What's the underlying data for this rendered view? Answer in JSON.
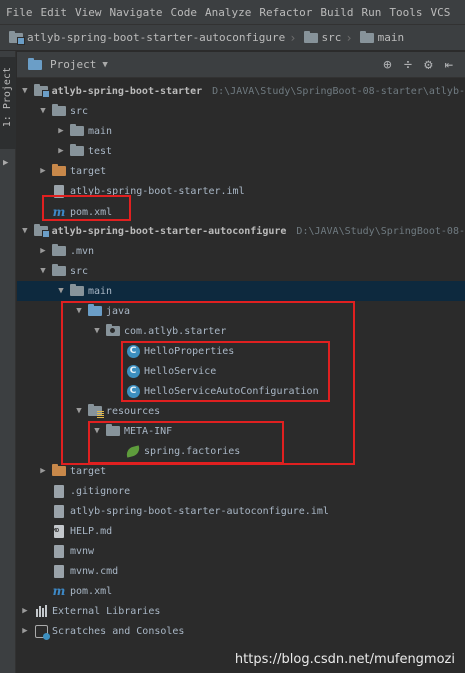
{
  "menu": [
    "File",
    "Edit",
    "View",
    "Navigate",
    "Code",
    "Analyze",
    "Refactor",
    "Build",
    "Run",
    "Tools",
    "VCS"
  ],
  "breadcrumb": [
    "atlyb-spring-boot-starter-autoconfigure",
    "src",
    "main"
  ],
  "side_tab_label": "1: Project",
  "panel": {
    "title": "Project"
  },
  "tree": [
    {
      "label": "atlyb-spring-boot-starter",
      "path": "D:\\JAVA\\Study\\SpringBoot-08-starter\\atlyb-"
    },
    {
      "label": "src"
    },
    {
      "label": "main"
    },
    {
      "label": "test"
    },
    {
      "label": "target"
    },
    {
      "label": "atlyb-spring-boot-starter.iml"
    },
    {
      "label": "pom.xml"
    },
    {
      "label": "atlyb-spring-boot-starter-autoconfigure",
      "path": "D:\\JAVA\\Study\\SpringBoot-08-"
    },
    {
      "label": ".mvn"
    },
    {
      "label": "src"
    },
    {
      "label": "main"
    },
    {
      "label": "java"
    },
    {
      "label": "com.atlyb.starter"
    },
    {
      "label": "HelloProperties"
    },
    {
      "label": "HelloService"
    },
    {
      "label": "HelloServiceAutoConfiguration"
    },
    {
      "label": "resources"
    },
    {
      "label": "META-INF"
    },
    {
      "label": "spring.factories"
    },
    {
      "label": "target"
    },
    {
      "label": ".gitignore"
    },
    {
      "label": "atlyb-spring-boot-starter-autoconfigure.iml"
    },
    {
      "label": "HELP.md"
    },
    {
      "label": "mvnw"
    },
    {
      "label": "mvnw.cmd"
    },
    {
      "label": "pom.xml"
    },
    {
      "label": "External Libraries"
    },
    {
      "label": "Scratches and Consoles"
    }
  ],
  "watermark": "https://blog.csdn.net/mufengmozi",
  "colors": {
    "highlight": "#e02020",
    "background": "#2b2b2b",
    "class_icon": "#3d8fbf",
    "maven_icon": "#3d89c7"
  }
}
